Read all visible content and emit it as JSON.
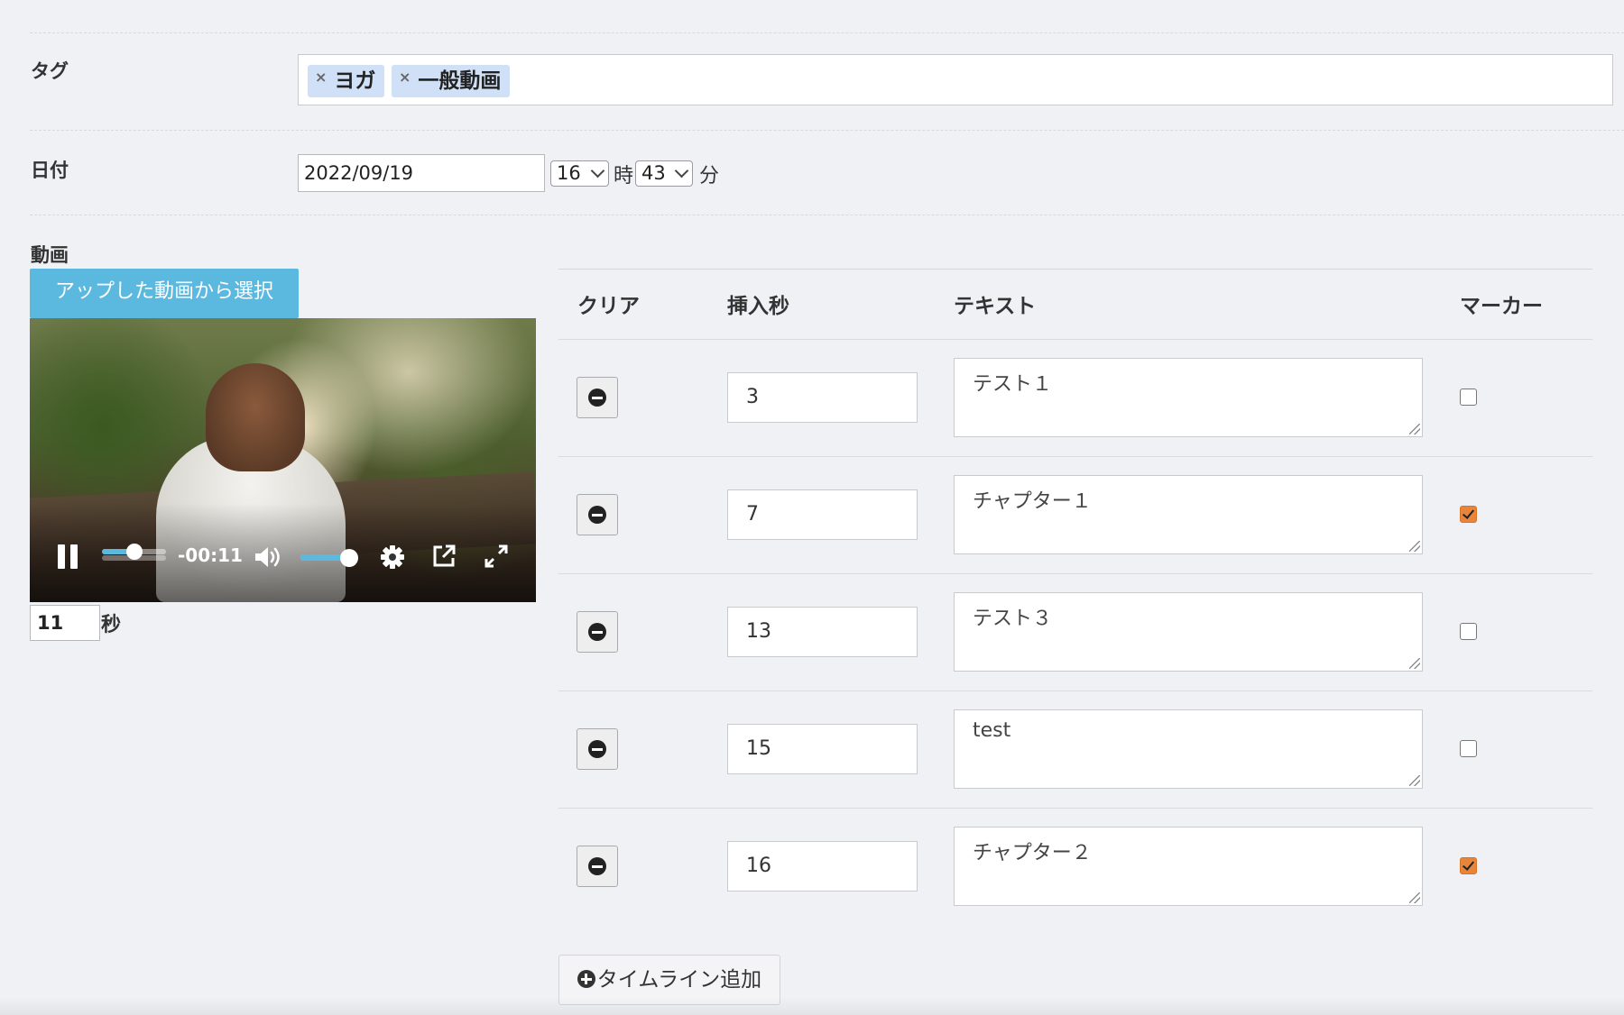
{
  "tags": {
    "label": "タグ",
    "items": [
      {
        "remove": "×",
        "text": "ヨガ"
      },
      {
        "remove": "×",
        "text": "一般動画"
      }
    ]
  },
  "date": {
    "label": "日付",
    "value": "2022/09/19",
    "hour": "16",
    "hour_unit": "時",
    "minute": "43",
    "minute_unit": "分"
  },
  "video": {
    "label": "動画",
    "select_button": "アップした動画から選択",
    "time_remaining": "-00:11",
    "seek_progress": 0.5,
    "volume_level": 0.85,
    "seconds_value": "11",
    "seconds_unit": "秒"
  },
  "timeline": {
    "headers": {
      "clear": "クリア",
      "insert_sec": "挿入秒",
      "text": "テキスト",
      "marker": "マーカー"
    },
    "rows": [
      {
        "sec": "3",
        "text": "テスト１",
        "marker": false
      },
      {
        "sec": "7",
        "text": "チャプター１",
        "marker": true
      },
      {
        "sec": "13",
        "text": "テスト３",
        "marker": false
      },
      {
        "sec": "15",
        "text": "test",
        "marker": false
      },
      {
        "sec": "16",
        "text": "チャプター２",
        "marker": true
      }
    ],
    "add_button": "タイムライン追加"
  },
  "colors": {
    "accent": "#5bb8df",
    "marker_checked": "#e8853a",
    "tag_bg": "#cfe0f7"
  }
}
